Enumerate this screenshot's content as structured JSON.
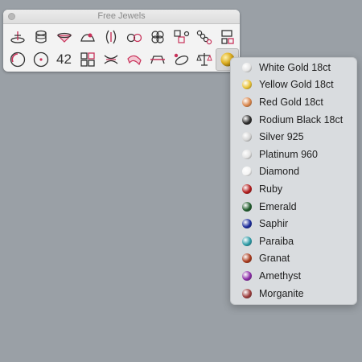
{
  "window": {
    "title": "Free Jewels"
  },
  "toolbar": {
    "number_label": "42",
    "row1": [
      "pedestal-icon",
      "ring-profile-icon",
      "gem-setting-icon",
      "prong-icon",
      "curve-arrow-icon",
      "bead-icon",
      "cluster-icon",
      "chain-link-icon",
      "chain-strand-icon",
      "box-icon"
    ],
    "row2": [
      "circle-spiral-icon",
      "circle-dot-icon",
      "number-text",
      "grid-squares-icon",
      "arch-icon",
      "bangle-icon",
      "bridge-icon",
      "lasso-gem-icon",
      "scale-icon",
      "material-sphere-icon"
    ]
  },
  "material_menu": {
    "items": [
      {
        "label": "White Gold 18ct",
        "color": "#e6e6e6"
      },
      {
        "label": "Yellow Gold 18ct",
        "color": "#e8c133"
      },
      {
        "label": "Red Gold 18ct",
        "color": "#d9854a"
      },
      {
        "label": "Rodium Black 18ct",
        "color": "#2a2a2a"
      },
      {
        "label": "Silver 925",
        "color": "#d4d4d4"
      },
      {
        "label": "Platinum 960",
        "color": "#e2e2e2"
      },
      {
        "label": "Diamond",
        "color": "#f4f4f4"
      },
      {
        "label": "Ruby",
        "color": "#b11a1a"
      },
      {
        "label": "Emerald",
        "color": "#1e5a2a"
      },
      {
        "label": "Saphir",
        "color": "#1a2a9a"
      },
      {
        "label": "Paraiba",
        "color": "#2a9aa6"
      },
      {
        "label": "Granat",
        "color": "#a8381a"
      },
      {
        "label": "Amethyst",
        "color": "#8a2aa6"
      },
      {
        "label": "Morganite",
        "color": "#9a3a3a"
      }
    ]
  }
}
